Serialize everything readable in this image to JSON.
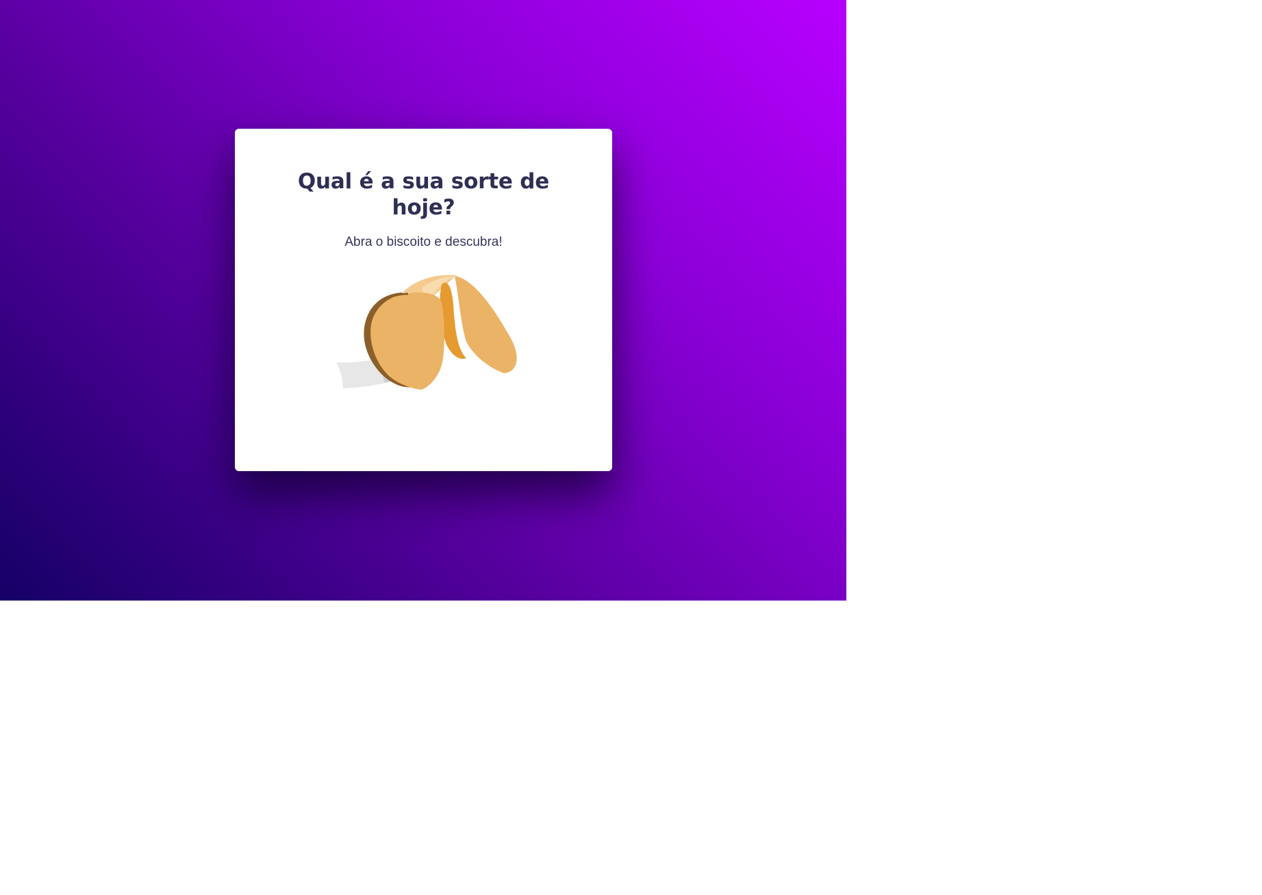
{
  "card": {
    "title": "Qual é a sua sorte de hoje?",
    "subtitle": "Abra o biscoito e descubra!",
    "cookie_icon": "fortune-cookie-icon"
  },
  "colors": {
    "background_start": "#150066",
    "background_end": "#b700ff",
    "card_background": "#ffffff",
    "title_text": "#2f2f55",
    "cookie_main": "#ebb366",
    "cookie_inner": "#e59b30",
    "cookie_shadow": "#8a5f2a",
    "cookie_highlight": "#f5ca8f",
    "paper_light": "#e7e7e7",
    "paper_dark": "#cfcfcf"
  }
}
